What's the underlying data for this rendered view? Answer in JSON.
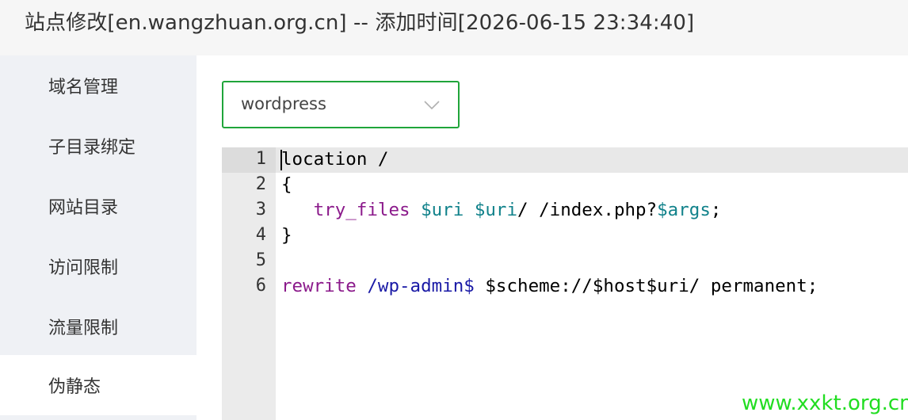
{
  "header": {
    "title": "站点修改[en.wangzhuan.org.cn] -- 添加时间[2026-06-15 23:34:40]"
  },
  "sidebar": {
    "items": [
      {
        "label": "域名管理"
      },
      {
        "label": "子目录绑定"
      },
      {
        "label": "网站目录"
      },
      {
        "label": "访问限制"
      },
      {
        "label": "流量限制"
      },
      {
        "label": "伪静态"
      }
    ],
    "active_index": 5
  },
  "template_select": {
    "value": "wordpress",
    "icon": "chevron-down-icon"
  },
  "editor": {
    "line_numbers": [
      "1",
      "2",
      "3",
      "4",
      "5",
      "6"
    ],
    "lines": [
      [
        {
          "t": "location /",
          "c": ""
        }
      ],
      [
        {
          "t": "{",
          "c": ""
        }
      ],
      [
        {
          "t": "   ",
          "c": ""
        },
        {
          "t": "try_files",
          "c": "kw"
        },
        {
          "t": " ",
          "c": ""
        },
        {
          "t": "$uri",
          "c": "var"
        },
        {
          "t": " ",
          "c": ""
        },
        {
          "t": "$uri",
          "c": "var"
        },
        {
          "t": "/ /index.php?",
          "c": ""
        },
        {
          "t": "$args",
          "c": "var"
        },
        {
          "t": ";",
          "c": ""
        }
      ],
      [
        {
          "t": "}",
          "c": ""
        }
      ],
      [
        {
          "t": "",
          "c": ""
        }
      ],
      [
        {
          "t": "rewrite",
          "c": "kw"
        },
        {
          "t": " ",
          "c": ""
        },
        {
          "t": "/wp-admin$",
          "c": "re"
        },
        {
          "t": " $scheme://$host$uri/ permanent;",
          "c": ""
        }
      ]
    ],
    "colors": {
      "keyword": "#8b1a8b",
      "variable": "#11828b",
      "regex": "#1a1aa6"
    }
  },
  "watermark": {
    "text": "www.xxkt.org.cn"
  },
  "colors": {
    "accent": "#20a53a",
    "sidebar_bg": "#eff1f5",
    "header_bg": "#f6f6f6"
  }
}
